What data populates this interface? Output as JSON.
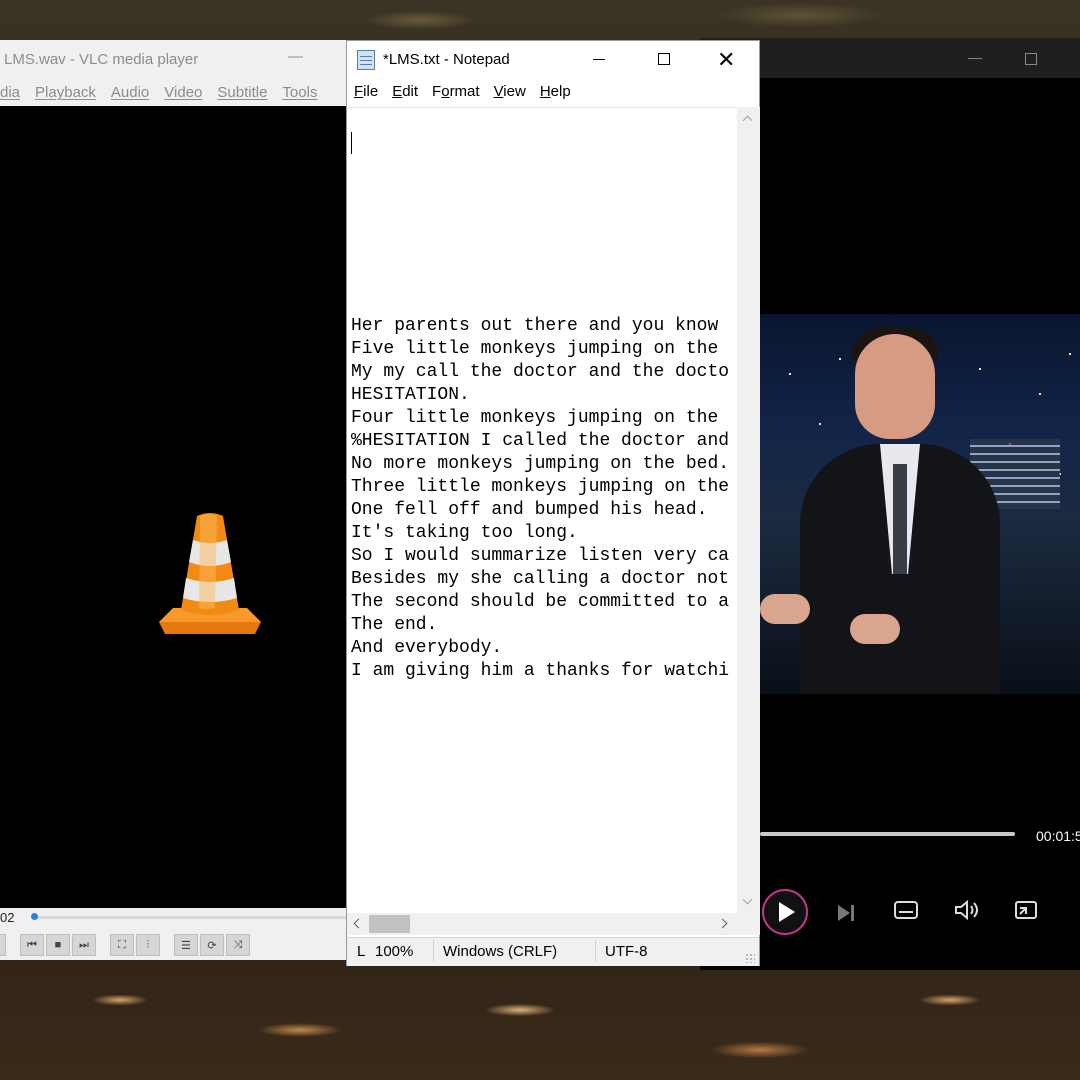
{
  "vlc": {
    "title": "LMS.wav - VLC media player",
    "min_glyph": "—",
    "menu": [
      "dia",
      "Playback",
      "Audio",
      "Video",
      "Subtitle",
      "Tools"
    ],
    "elapsed": "02",
    "progress": 0.0
  },
  "notepad": {
    "title": "*LMS.txt - Notepad",
    "close_glyph": "✕",
    "menu": [
      {
        "key": "F",
        "rest": "ile"
      },
      {
        "key": "E",
        "rest": "dit"
      },
      {
        "key": "",
        "pre": "F",
        "key2": "o",
        "rest": "rmat"
      },
      {
        "key": "V",
        "rest": "iew"
      },
      {
        "key": "H",
        "rest": "elp"
      }
    ],
    "lines": [
      "Her parents out there and you know",
      "Five little monkeys jumping on the",
      "My my call the doctor and the docto",
      "HESITATION.",
      "Four little monkeys jumping on the",
      "%HESITATION I called the doctor and",
      "No more monkeys jumping on the bed.",
      "Three little monkeys jumping on the",
      "One fell off and bumped his head.",
      "It's taking too long.",
      "So I would summarize listen very ca",
      "Besides my she calling a doctor not",
      "The second should be committed to a",
      "The end.",
      "And everybody.",
      "I am giving him a thanks for watchi"
    ],
    "status": {
      "position": "L",
      "zoom": "100%",
      "line_ending": "Windows (CRLF)",
      "encoding": "UTF-8"
    }
  },
  "media_player": {
    "time": "00:01:5",
    "min_glyph": "—",
    "progress": 0.0
  }
}
